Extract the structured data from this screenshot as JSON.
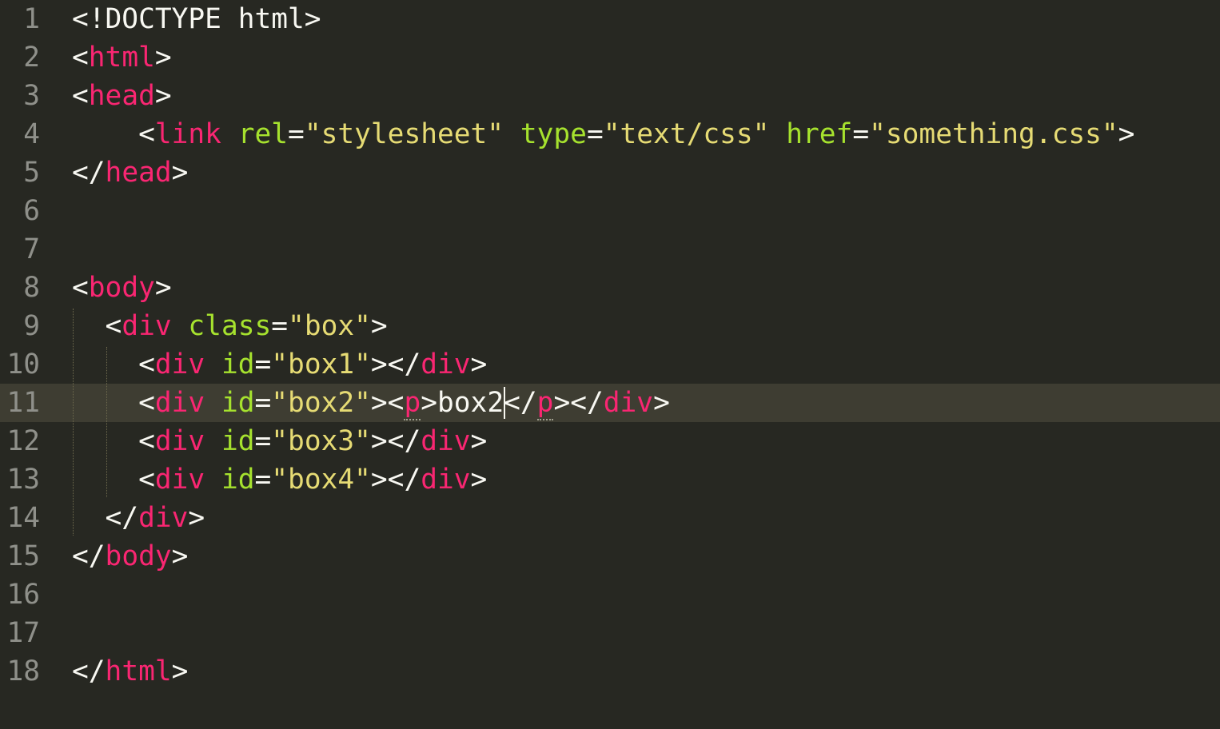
{
  "editor": {
    "theme": {
      "background": "#272822",
      "active_line": "#3e3d32",
      "gutter_text": "#8f908a",
      "punctuation": "#f8f8f2",
      "tag": "#f92672",
      "attribute": "#a6e22e",
      "string": "#e6db74"
    },
    "active_line": 11,
    "lines": [
      {
        "number": "1",
        "tokens": [
          {
            "type": "punct",
            "text": "<!DOCTYPE html>"
          }
        ]
      },
      {
        "number": "2",
        "tokens": [
          {
            "type": "punct",
            "text": "<"
          },
          {
            "type": "tag",
            "text": "html"
          },
          {
            "type": "punct",
            "text": ">"
          }
        ]
      },
      {
        "number": "3",
        "tokens": [
          {
            "type": "punct",
            "text": "<"
          },
          {
            "type": "tag",
            "text": "head"
          },
          {
            "type": "punct",
            "text": ">"
          }
        ]
      },
      {
        "number": "4",
        "tokens": [
          {
            "type": "punct",
            "text": "    <"
          },
          {
            "type": "tag",
            "text": "link"
          },
          {
            "type": "punct",
            "text": " "
          },
          {
            "type": "attr",
            "text": "rel"
          },
          {
            "type": "punct",
            "text": "="
          },
          {
            "type": "str",
            "text": "\"stylesheet\""
          },
          {
            "type": "punct",
            "text": " "
          },
          {
            "type": "attr",
            "text": "type"
          },
          {
            "type": "punct",
            "text": "="
          },
          {
            "type": "str",
            "text": "\"text/css\""
          },
          {
            "type": "punct",
            "text": " "
          },
          {
            "type": "attr",
            "text": "href"
          },
          {
            "type": "punct",
            "text": "="
          },
          {
            "type": "str",
            "text": "\"something.css\""
          },
          {
            "type": "punct",
            "text": ">"
          }
        ]
      },
      {
        "number": "5",
        "tokens": [
          {
            "type": "punct",
            "text": "</"
          },
          {
            "type": "tag",
            "text": "head"
          },
          {
            "type": "punct",
            "text": ">"
          }
        ]
      },
      {
        "number": "6",
        "tokens": []
      },
      {
        "number": "7",
        "tokens": []
      },
      {
        "number": "8",
        "tokens": [
          {
            "type": "punct",
            "text": "<"
          },
          {
            "type": "tag",
            "text": "body"
          },
          {
            "type": "punct",
            "text": ">"
          }
        ]
      },
      {
        "number": "9",
        "tokens": [
          {
            "type": "punct",
            "text": "  <"
          },
          {
            "type": "tag",
            "text": "div"
          },
          {
            "type": "punct",
            "text": " "
          },
          {
            "type": "attr",
            "text": "class"
          },
          {
            "type": "punct",
            "text": "="
          },
          {
            "type": "str",
            "text": "\"box\""
          },
          {
            "type": "punct",
            "text": ">"
          }
        ]
      },
      {
        "number": "10",
        "tokens": [
          {
            "type": "punct",
            "text": "    <"
          },
          {
            "type": "tag",
            "text": "div"
          },
          {
            "type": "punct",
            "text": " "
          },
          {
            "type": "attr",
            "text": "id"
          },
          {
            "type": "punct",
            "text": "="
          },
          {
            "type": "str",
            "text": "\"box1\""
          },
          {
            "type": "punct",
            "text": "></"
          },
          {
            "type": "tag",
            "text": "div"
          },
          {
            "type": "punct",
            "text": ">"
          }
        ]
      },
      {
        "number": "11",
        "tokens": [
          {
            "type": "punct",
            "text": "    <"
          },
          {
            "type": "tag",
            "text": "div"
          },
          {
            "type": "punct",
            "text": " "
          },
          {
            "type": "attr",
            "text": "id"
          },
          {
            "type": "punct",
            "text": "="
          },
          {
            "type": "str",
            "text": "\"box2\""
          },
          {
            "type": "punct",
            "text": "><"
          },
          {
            "type": "tag",
            "text": "p",
            "matched": true
          },
          {
            "type": "punct",
            "text": ">"
          },
          {
            "type": "text",
            "text": "box2"
          },
          {
            "type": "caret"
          },
          {
            "type": "punct",
            "text": "</"
          },
          {
            "type": "tag",
            "text": "p",
            "matched": true
          },
          {
            "type": "punct",
            "text": "></"
          },
          {
            "type": "tag",
            "text": "div"
          },
          {
            "type": "punct",
            "text": ">"
          }
        ]
      },
      {
        "number": "12",
        "tokens": [
          {
            "type": "punct",
            "text": "    <"
          },
          {
            "type": "tag",
            "text": "div"
          },
          {
            "type": "punct",
            "text": " "
          },
          {
            "type": "attr",
            "text": "id"
          },
          {
            "type": "punct",
            "text": "="
          },
          {
            "type": "str",
            "text": "\"box3\""
          },
          {
            "type": "punct",
            "text": "></"
          },
          {
            "type": "tag",
            "text": "div"
          },
          {
            "type": "punct",
            "text": ">"
          }
        ]
      },
      {
        "number": "13",
        "tokens": [
          {
            "type": "punct",
            "text": "    <"
          },
          {
            "type": "tag",
            "text": "div"
          },
          {
            "type": "punct",
            "text": " "
          },
          {
            "type": "attr",
            "text": "id"
          },
          {
            "type": "punct",
            "text": "="
          },
          {
            "type": "str",
            "text": "\"box4\""
          },
          {
            "type": "punct",
            "text": "></"
          },
          {
            "type": "tag",
            "text": "div"
          },
          {
            "type": "punct",
            "text": ">"
          }
        ]
      },
      {
        "number": "14",
        "tokens": [
          {
            "type": "punct",
            "text": "  </"
          },
          {
            "type": "tag",
            "text": "div"
          },
          {
            "type": "punct",
            "text": ">"
          }
        ]
      },
      {
        "number": "15",
        "tokens": [
          {
            "type": "punct",
            "text": "</"
          },
          {
            "type": "tag",
            "text": "body"
          },
          {
            "type": "punct",
            "text": ">"
          }
        ]
      },
      {
        "number": "16",
        "tokens": []
      },
      {
        "number": "17",
        "tokens": []
      },
      {
        "number": "18",
        "tokens": [
          {
            "type": "punct",
            "text": "</"
          },
          {
            "type": "tag",
            "text": "html"
          },
          {
            "type": "punct",
            "text": ">"
          }
        ]
      }
    ]
  }
}
